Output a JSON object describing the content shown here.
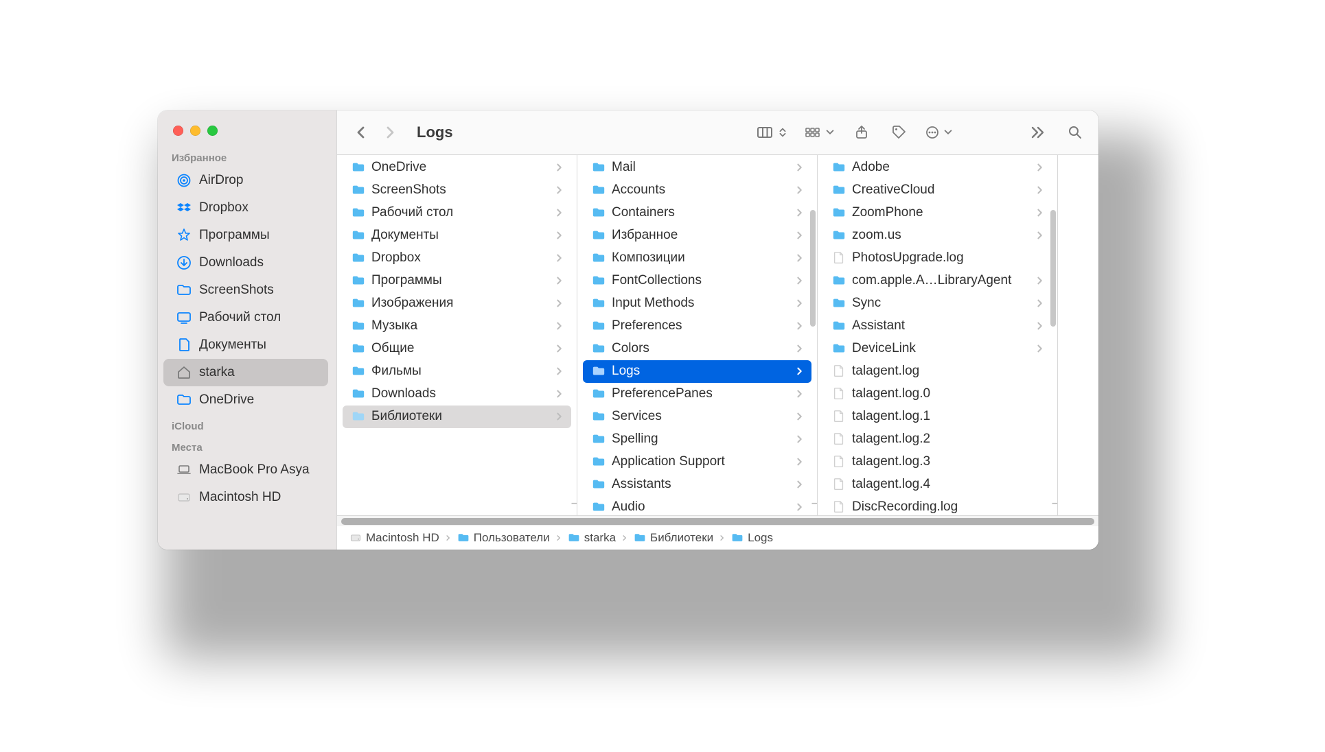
{
  "toolbar": {
    "title": "Logs"
  },
  "sidebar": {
    "sections": [
      {
        "title": "Избранное",
        "items": [
          {
            "label": "AirDrop",
            "icon": "airdrop",
            "selected": false
          },
          {
            "label": "Dropbox",
            "icon": "dropbox",
            "selected": false
          },
          {
            "label": "Программы",
            "icon": "apps",
            "selected": false
          },
          {
            "label": "Downloads",
            "icon": "download",
            "selected": false
          },
          {
            "label": "ScreenShots",
            "icon": "folder-thin",
            "selected": false
          },
          {
            "label": "Рабочий стол",
            "icon": "desktop",
            "selected": false
          },
          {
            "label": "Документы",
            "icon": "doc",
            "selected": false
          },
          {
            "label": "starka",
            "icon": "home",
            "selected": true
          },
          {
            "label": "OneDrive",
            "icon": "folder-thin",
            "selected": false
          }
        ]
      },
      {
        "title": "iCloud",
        "items": []
      },
      {
        "title": "Места",
        "items": [
          {
            "label": "MacBook Pro Asya",
            "icon": "laptop",
            "selected": false
          },
          {
            "label": "Macintosh HD",
            "icon": "hdd",
            "selected": false
          }
        ]
      }
    ]
  },
  "columns": [
    {
      "has_scrollbar": false,
      "items": [
        {
          "label": "OneDrive",
          "kind": "folder",
          "has_arrow": true,
          "selected": null
        },
        {
          "label": "ScreenShots",
          "kind": "folder",
          "has_arrow": true,
          "selected": null
        },
        {
          "label": "Рабочий стол",
          "kind": "folder",
          "has_arrow": true,
          "selected": null
        },
        {
          "label": "Документы",
          "kind": "folder",
          "has_arrow": true,
          "selected": null
        },
        {
          "label": "Dropbox",
          "kind": "folder",
          "has_arrow": true,
          "selected": null
        },
        {
          "label": "Программы",
          "kind": "folder",
          "has_arrow": true,
          "selected": null
        },
        {
          "label": "Изображения",
          "kind": "folder",
          "has_arrow": true,
          "selected": null
        },
        {
          "label": "Музыка",
          "kind": "folder",
          "has_arrow": true,
          "selected": null
        },
        {
          "label": "Общие",
          "kind": "folder",
          "has_arrow": true,
          "selected": null
        },
        {
          "label": "Фильмы",
          "kind": "folder",
          "has_arrow": true,
          "selected": null
        },
        {
          "label": "Downloads",
          "kind": "folder",
          "has_arrow": true,
          "selected": null
        },
        {
          "label": "Библиотеки",
          "kind": "folder",
          "has_arrow": true,
          "selected": "grey"
        }
      ]
    },
    {
      "has_scrollbar": true,
      "items": [
        {
          "label": "Mail",
          "kind": "folder",
          "has_arrow": true,
          "selected": null
        },
        {
          "label": "Accounts",
          "kind": "folder",
          "has_arrow": true,
          "selected": null
        },
        {
          "label": "Containers",
          "kind": "folder",
          "has_arrow": true,
          "selected": null
        },
        {
          "label": "Избранное",
          "kind": "folder",
          "has_arrow": true,
          "selected": null
        },
        {
          "label": "Композиции",
          "kind": "folder",
          "has_arrow": true,
          "selected": null
        },
        {
          "label": "FontCollections",
          "kind": "folder",
          "has_arrow": true,
          "selected": null
        },
        {
          "label": "Input Methods",
          "kind": "folder",
          "has_arrow": true,
          "selected": null
        },
        {
          "label": "Preferences",
          "kind": "folder",
          "has_arrow": true,
          "selected": null
        },
        {
          "label": "Colors",
          "kind": "folder",
          "has_arrow": true,
          "selected": null
        },
        {
          "label": "Logs",
          "kind": "folder",
          "has_arrow": true,
          "selected": "blue"
        },
        {
          "label": "PreferencePanes",
          "kind": "folder",
          "has_arrow": true,
          "selected": null
        },
        {
          "label": "Services",
          "kind": "folder",
          "has_arrow": true,
          "selected": null
        },
        {
          "label": "Spelling",
          "kind": "folder",
          "has_arrow": true,
          "selected": null
        },
        {
          "label": "Application Support",
          "kind": "folder",
          "has_arrow": true,
          "selected": null
        },
        {
          "label": "Assistants",
          "kind": "folder",
          "has_arrow": true,
          "selected": null
        },
        {
          "label": "Audio",
          "kind": "folder",
          "has_arrow": true,
          "selected": null
        }
      ]
    },
    {
      "has_scrollbar": true,
      "items": [
        {
          "label": "Adobe",
          "kind": "folder",
          "has_arrow": true,
          "selected": null
        },
        {
          "label": "CreativeCloud",
          "kind": "folder",
          "has_arrow": true,
          "selected": null
        },
        {
          "label": "ZoomPhone",
          "kind": "folder",
          "has_arrow": true,
          "selected": null
        },
        {
          "label": "zoom.us",
          "kind": "folder",
          "has_arrow": true,
          "selected": null
        },
        {
          "label": "PhotosUpgrade.log",
          "kind": "file",
          "has_arrow": false,
          "selected": null
        },
        {
          "label": "com.apple.A…LibraryAgent",
          "kind": "folder",
          "has_arrow": true,
          "selected": null
        },
        {
          "label": "Sync",
          "kind": "folder",
          "has_arrow": true,
          "selected": null
        },
        {
          "label": "Assistant",
          "kind": "folder",
          "has_arrow": true,
          "selected": null
        },
        {
          "label": "DeviceLink",
          "kind": "folder",
          "has_arrow": true,
          "selected": null
        },
        {
          "label": "talagent.log",
          "kind": "file",
          "has_arrow": false,
          "selected": null
        },
        {
          "label": "talagent.log.0",
          "kind": "file",
          "has_arrow": false,
          "selected": null
        },
        {
          "label": "talagent.log.1",
          "kind": "file",
          "has_arrow": false,
          "selected": null
        },
        {
          "label": "talagent.log.2",
          "kind": "file",
          "has_arrow": false,
          "selected": null
        },
        {
          "label": "talagent.log.3",
          "kind": "file",
          "has_arrow": false,
          "selected": null
        },
        {
          "label": "talagent.log.4",
          "kind": "file",
          "has_arrow": false,
          "selected": null
        },
        {
          "label": "DiscRecording.log",
          "kind": "file",
          "has_arrow": false,
          "selected": null
        }
      ]
    }
  ],
  "pathbar": [
    {
      "label": "Macintosh HD",
      "icon": "hdd"
    },
    {
      "label": "Пользователи",
      "icon": "folder"
    },
    {
      "label": "starka",
      "icon": "folder"
    },
    {
      "label": "Библиотеки",
      "icon": "folder"
    },
    {
      "label": "Logs",
      "icon": "folder"
    }
  ]
}
